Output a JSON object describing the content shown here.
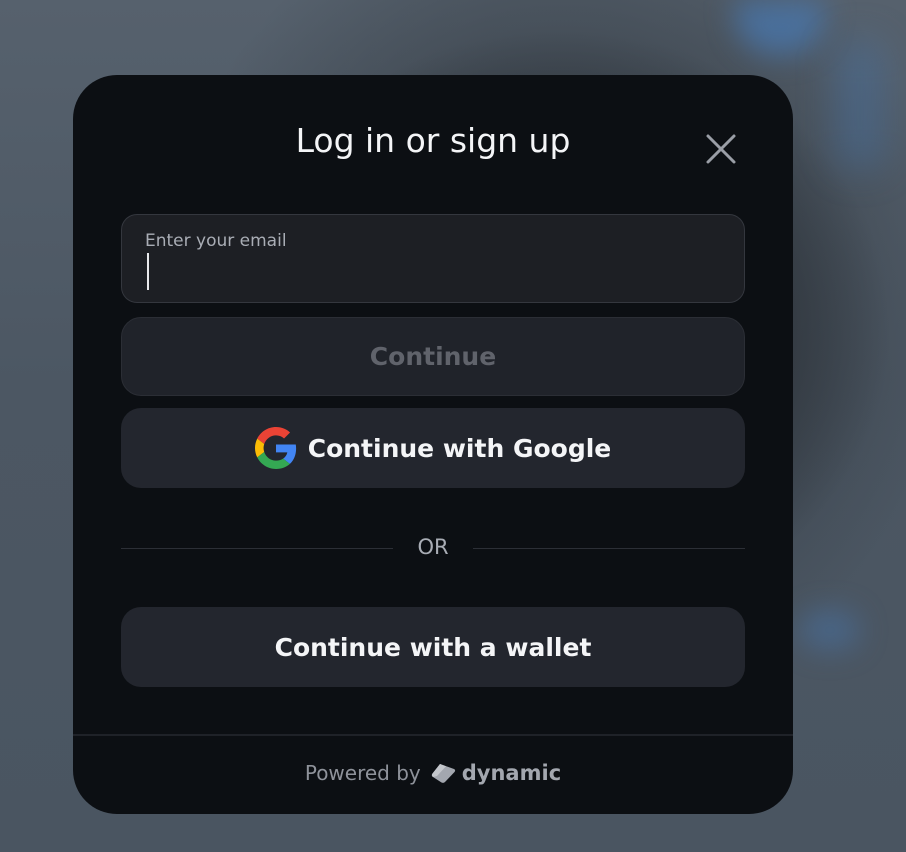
{
  "modal": {
    "title": "Log in or sign up",
    "close_icon": "close-icon"
  },
  "email": {
    "label": "Enter your email",
    "value": ""
  },
  "buttons": {
    "continue_label": "Continue",
    "google_label": "Continue with Google",
    "google_icon": "google-logo-icon",
    "wallet_label": "Continue with a wallet"
  },
  "divider": {
    "label": "OR"
  },
  "footer": {
    "powered_by": "Powered by",
    "brand": "dynamic",
    "brand_icon": "dynamic-logo-icon"
  },
  "colors": {
    "modal_bg": "#0c0f13",
    "button_bg": "#23262e",
    "disabled_text": "#60636b",
    "text": "#f4f5f7",
    "muted_text": "#a9adb5"
  }
}
